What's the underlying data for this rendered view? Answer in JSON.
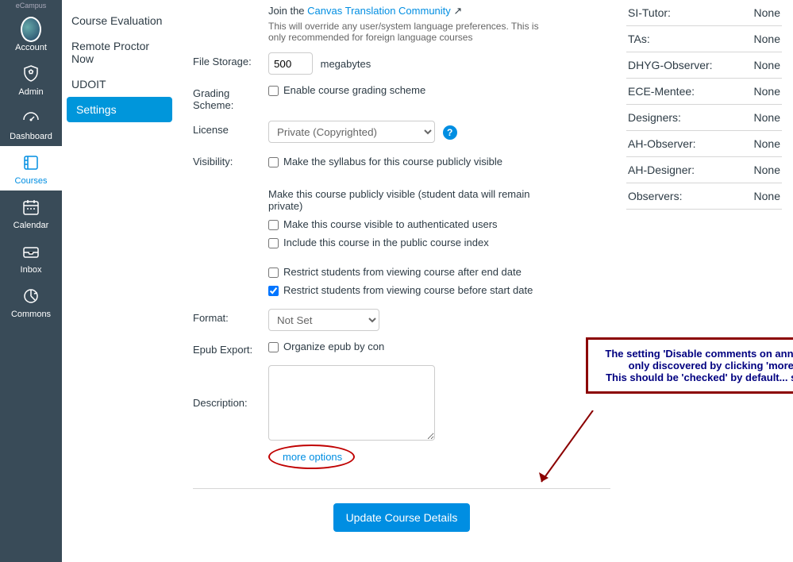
{
  "global_nav": {
    "top_label": "eCampus",
    "items": [
      {
        "key": "account",
        "label": "Account"
      },
      {
        "key": "admin",
        "label": "Admin"
      },
      {
        "key": "dashboard",
        "label": "Dashboard"
      },
      {
        "key": "courses",
        "label": "Courses"
      },
      {
        "key": "calendar",
        "label": "Calendar"
      },
      {
        "key": "inbox",
        "label": "Inbox"
      },
      {
        "key": "commons",
        "label": "Commons"
      }
    ],
    "active": "courses"
  },
  "course_nav": {
    "items": [
      {
        "key": "course-evaluation",
        "label": "Course Evaluation"
      },
      {
        "key": "remote-proctor",
        "label": "Remote Proctor Now"
      },
      {
        "key": "udoit",
        "label": "UDOIT"
      },
      {
        "key": "settings",
        "label": "Settings"
      }
    ],
    "active": "settings"
  },
  "form": {
    "join_prefix": "Join the ",
    "join_link": "Canvas Translation Community",
    "join_note": "This will override any user/system language preferences. This is only recommended for foreign language courses",
    "file_storage_label": "File Storage:",
    "file_storage_value": "500",
    "file_storage_unit": "megabytes",
    "grading_label": "Grading Scheme:",
    "grading_checkbox": "Enable course grading scheme",
    "license_label": "License",
    "license_value": "Private (Copyrighted)",
    "visibility_label": "Visibility:",
    "vis_syllabus": "Make the syllabus for this course publicly visible",
    "vis_public": "Make this course publicly visible (student data will remain private)",
    "vis_auth": "Make this course visible to authenticated users",
    "vis_index": "Include this course in the public course index",
    "restrict_after": "Restrict students from viewing course after end date",
    "restrict_before": "Restrict students from viewing course before start date",
    "format_label": "Format:",
    "format_value": "Not Set",
    "epub_label": "Epub Export:",
    "epub_checkbox_prefix": "Organize epub by con",
    "description_label": "Description:",
    "more_options": "more options",
    "submit": "Update Course Details"
  },
  "roles": [
    {
      "name": "SI-Tutor:",
      "value": "None"
    },
    {
      "name": "TAs:",
      "value": "None"
    },
    {
      "name": "DHYG-Observer:",
      "value": "None"
    },
    {
      "name": "ECE-Mentee:",
      "value": "None"
    },
    {
      "name": "Designers:",
      "value": "None"
    },
    {
      "name": "AH-Observer:",
      "value": "None"
    },
    {
      "name": "AH-Designer:",
      "value": "None"
    },
    {
      "name": "Observers:",
      "value": "None"
    }
  ],
  "annotation": {
    "line1": "The setting 'Disable comments on announcements' is",
    "line2": "only discovered by clicking 'more options'...",
    "line3": "This should be 'checked' by default... see next image."
  }
}
